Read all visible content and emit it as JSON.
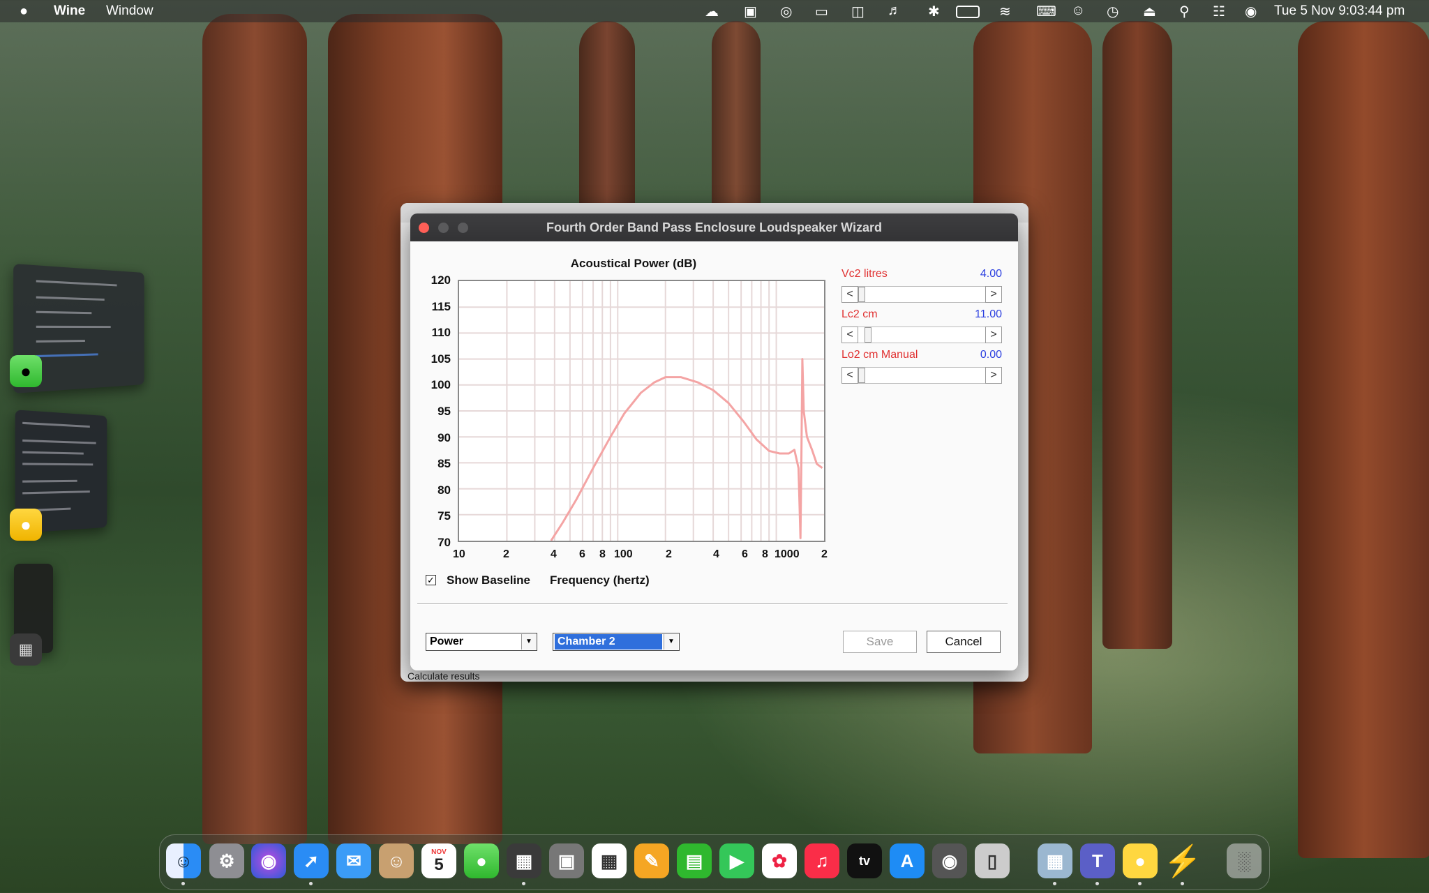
{
  "menubar": {
    "apple": "",
    "app": "Wine",
    "window": "Window",
    "datetime": "Tue 5 Nov  9:03:44 pm"
  },
  "background_window": {
    "button_label": "Calculate results"
  },
  "dialog": {
    "title": "Fourth Order Band Pass Enclosure Loudspeaker Wizard",
    "chart": {
      "title": "Acoustical Power (dB)",
      "xlabel": "Frequency (hertz)",
      "ytick_labels": [
        "120",
        "115",
        "110",
        "105",
        "100",
        "95",
        "90",
        "85",
        "80",
        "75",
        "70"
      ],
      "xtick_labels": [
        "10",
        "2",
        "4",
        "6",
        "8",
        "100",
        "2",
        "4",
        "6",
        "8",
        "1000",
        "2"
      ]
    },
    "show_baseline": {
      "label": "Show Baseline",
      "checked": true,
      "mark": "✓"
    },
    "params": [
      {
        "label": "Vc2 litres",
        "value": "4.00",
        "level": 0.0
      },
      {
        "label": "Lc2  cm",
        "value": "11.00",
        "level": 0.05
      },
      {
        "label": "Lo2  cm  Manual",
        "value": "0.00",
        "level": 0.0
      }
    ],
    "scroll_left": "<",
    "scroll_right": ">",
    "mode_select": "Power",
    "chamber_select": "Chamber 2",
    "save_label": "Save",
    "cancel_label": "Cancel"
  },
  "dock": {
    "calendar_month": "NOV",
    "calendar_day": "5",
    "tv_label": "tv"
  },
  "chart_data": {
    "type": "line",
    "title": "Acoustical Power (dB)",
    "xlabel": "Frequency (hertz)",
    "ylabel": "",
    "x_scale": "log",
    "xlim": [
      10,
      2000
    ],
    "ylim": [
      70,
      120
    ],
    "grid": true,
    "series": [
      {
        "color": "#f4a4a4",
        "points": [
          [
            38,
            70
          ],
          [
            45,
            73.5
          ],
          [
            55,
            78
          ],
          [
            70,
            84
          ],
          [
            90,
            90
          ],
          [
            110,
            94.5
          ],
          [
            140,
            98.5
          ],
          [
            170,
            100.5
          ],
          [
            200,
            101.5
          ],
          [
            250,
            101.5
          ],
          [
            320,
            100.5
          ],
          [
            400,
            99
          ],
          [
            500,
            96.5
          ],
          [
            620,
            93
          ],
          [
            750,
            89.5
          ],
          [
            900,
            87.3
          ],
          [
            1050,
            86.8
          ],
          [
            1200,
            86.8
          ],
          [
            1300,
            87.5
          ],
          [
            1380,
            84
          ],
          [
            1420,
            70.5
          ],
          [
            1440,
            87
          ],
          [
            1460,
            105
          ],
          [
            1490,
            95
          ],
          [
            1560,
            90
          ],
          [
            1680,
            87.5
          ],
          [
            1800,
            84.8
          ],
          [
            1950,
            84
          ]
        ]
      }
    ]
  }
}
